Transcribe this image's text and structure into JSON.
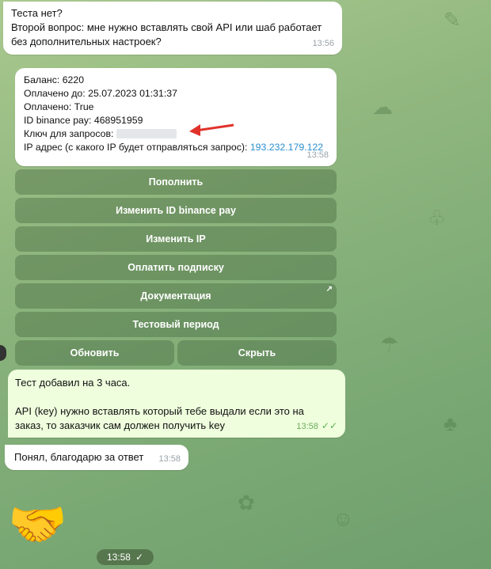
{
  "messages": {
    "incoming_question": {
      "line1": "Теста нет?",
      "line2": "Второй вопрос: мне нужно вставлять свой API или шаб работает",
      "line3": "без дополнительных настроек?",
      "time": "13:56"
    },
    "bot_info": {
      "balance": "Баланс: 6220",
      "paid_until": "Оплачено до: 25.07.2023 01:31:37",
      "paid": "Оплачено: True",
      "binance_id": "ID binance pay: 468951959",
      "key_label": "Ключ для запросов:",
      "ip_label": "IP адрес (с какого IP будет отправляться запрос):",
      "ip_value": "193.232.179.122",
      "time": "13:58"
    },
    "reply_test": {
      "line1": "Тест добавил на 3 часа.",
      "line2": "API (key) нужно вставлять который тебе выдали если это на",
      "line3": "заказ, то заказчик сам должен получить key",
      "time": "13:58"
    },
    "thanks": {
      "text": "Понял, благодарю за ответ",
      "time": "13:58"
    },
    "sticker": {
      "emoji": "🤝",
      "time": "13:58"
    }
  },
  "keyboard": {
    "topup": "Пополнить",
    "change_binance": "Изменить ID binance pay",
    "change_ip": "Изменить IP",
    "pay_subscription": "Оплатить подписку",
    "docs": "Документация",
    "docs_link_icon": "↗",
    "trial": "Тестовый период",
    "refresh": "Обновить",
    "hide": "Скрыть"
  },
  "icons": {
    "read_ticks": "✓✓",
    "sent_tick": "✓"
  }
}
